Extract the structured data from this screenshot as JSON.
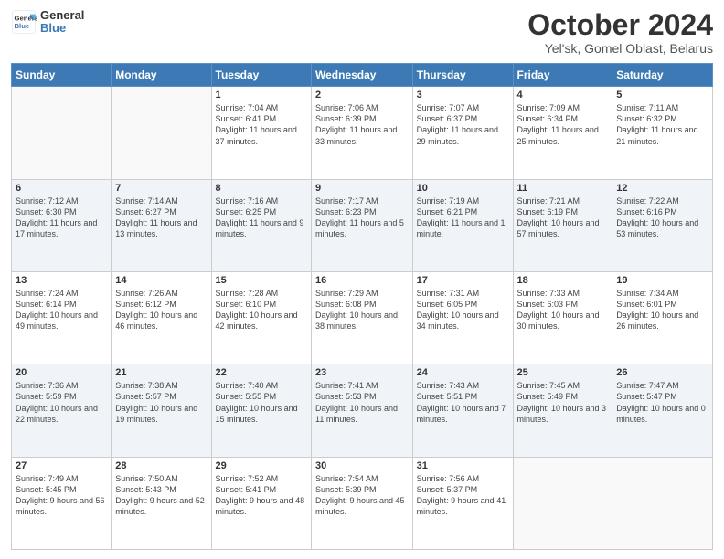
{
  "header": {
    "logo_line1": "General",
    "logo_line2": "Blue",
    "month": "October 2024",
    "location": "Yel'sk, Gomel Oblast, Belarus"
  },
  "weekdays": [
    "Sunday",
    "Monday",
    "Tuesday",
    "Wednesday",
    "Thursday",
    "Friday",
    "Saturday"
  ],
  "weeks": [
    [
      {
        "day": "",
        "info": ""
      },
      {
        "day": "",
        "info": ""
      },
      {
        "day": "1",
        "info": "Sunrise: 7:04 AM\nSunset: 6:41 PM\nDaylight: 11 hours and 37 minutes."
      },
      {
        "day": "2",
        "info": "Sunrise: 7:06 AM\nSunset: 6:39 PM\nDaylight: 11 hours and 33 minutes."
      },
      {
        "day": "3",
        "info": "Sunrise: 7:07 AM\nSunset: 6:37 PM\nDaylight: 11 hours and 29 minutes."
      },
      {
        "day": "4",
        "info": "Sunrise: 7:09 AM\nSunset: 6:34 PM\nDaylight: 11 hours and 25 minutes."
      },
      {
        "day": "5",
        "info": "Sunrise: 7:11 AM\nSunset: 6:32 PM\nDaylight: 11 hours and 21 minutes."
      }
    ],
    [
      {
        "day": "6",
        "info": "Sunrise: 7:12 AM\nSunset: 6:30 PM\nDaylight: 11 hours and 17 minutes."
      },
      {
        "day": "7",
        "info": "Sunrise: 7:14 AM\nSunset: 6:27 PM\nDaylight: 11 hours and 13 minutes."
      },
      {
        "day": "8",
        "info": "Sunrise: 7:16 AM\nSunset: 6:25 PM\nDaylight: 11 hours and 9 minutes."
      },
      {
        "day": "9",
        "info": "Sunrise: 7:17 AM\nSunset: 6:23 PM\nDaylight: 11 hours and 5 minutes."
      },
      {
        "day": "10",
        "info": "Sunrise: 7:19 AM\nSunset: 6:21 PM\nDaylight: 11 hours and 1 minute."
      },
      {
        "day": "11",
        "info": "Sunrise: 7:21 AM\nSunset: 6:19 PM\nDaylight: 10 hours and 57 minutes."
      },
      {
        "day": "12",
        "info": "Sunrise: 7:22 AM\nSunset: 6:16 PM\nDaylight: 10 hours and 53 minutes."
      }
    ],
    [
      {
        "day": "13",
        "info": "Sunrise: 7:24 AM\nSunset: 6:14 PM\nDaylight: 10 hours and 49 minutes."
      },
      {
        "day": "14",
        "info": "Sunrise: 7:26 AM\nSunset: 6:12 PM\nDaylight: 10 hours and 46 minutes."
      },
      {
        "day": "15",
        "info": "Sunrise: 7:28 AM\nSunset: 6:10 PM\nDaylight: 10 hours and 42 minutes."
      },
      {
        "day": "16",
        "info": "Sunrise: 7:29 AM\nSunset: 6:08 PM\nDaylight: 10 hours and 38 minutes."
      },
      {
        "day": "17",
        "info": "Sunrise: 7:31 AM\nSunset: 6:05 PM\nDaylight: 10 hours and 34 minutes."
      },
      {
        "day": "18",
        "info": "Sunrise: 7:33 AM\nSunset: 6:03 PM\nDaylight: 10 hours and 30 minutes."
      },
      {
        "day": "19",
        "info": "Sunrise: 7:34 AM\nSunset: 6:01 PM\nDaylight: 10 hours and 26 minutes."
      }
    ],
    [
      {
        "day": "20",
        "info": "Sunrise: 7:36 AM\nSunset: 5:59 PM\nDaylight: 10 hours and 22 minutes."
      },
      {
        "day": "21",
        "info": "Sunrise: 7:38 AM\nSunset: 5:57 PM\nDaylight: 10 hours and 19 minutes."
      },
      {
        "day": "22",
        "info": "Sunrise: 7:40 AM\nSunset: 5:55 PM\nDaylight: 10 hours and 15 minutes."
      },
      {
        "day": "23",
        "info": "Sunrise: 7:41 AM\nSunset: 5:53 PM\nDaylight: 10 hours and 11 minutes."
      },
      {
        "day": "24",
        "info": "Sunrise: 7:43 AM\nSunset: 5:51 PM\nDaylight: 10 hours and 7 minutes."
      },
      {
        "day": "25",
        "info": "Sunrise: 7:45 AM\nSunset: 5:49 PM\nDaylight: 10 hours and 3 minutes."
      },
      {
        "day": "26",
        "info": "Sunrise: 7:47 AM\nSunset: 5:47 PM\nDaylight: 10 hours and 0 minutes."
      }
    ],
    [
      {
        "day": "27",
        "info": "Sunrise: 7:49 AM\nSunset: 5:45 PM\nDaylight: 9 hours and 56 minutes."
      },
      {
        "day": "28",
        "info": "Sunrise: 7:50 AM\nSunset: 5:43 PM\nDaylight: 9 hours and 52 minutes."
      },
      {
        "day": "29",
        "info": "Sunrise: 7:52 AM\nSunset: 5:41 PM\nDaylight: 9 hours and 48 minutes."
      },
      {
        "day": "30",
        "info": "Sunrise: 7:54 AM\nSunset: 5:39 PM\nDaylight: 9 hours and 45 minutes."
      },
      {
        "day": "31",
        "info": "Sunrise: 7:56 AM\nSunset: 5:37 PM\nDaylight: 9 hours and 41 minutes."
      },
      {
        "day": "",
        "info": ""
      },
      {
        "day": "",
        "info": ""
      }
    ]
  ]
}
